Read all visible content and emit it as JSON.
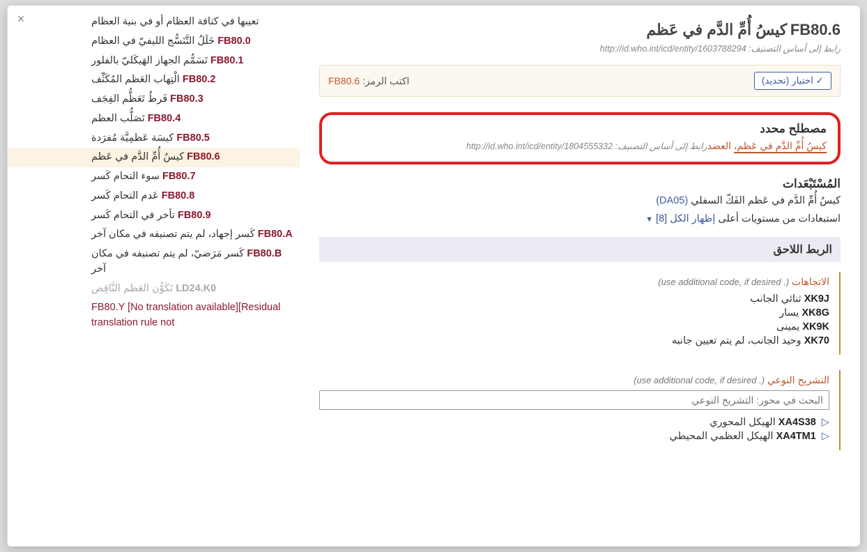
{
  "close_label": "×",
  "header": {
    "code": "FB80.6",
    "title": "كيسُ أُمِّ الدَّم في عَظم",
    "foundation_label": "رابط إلى أساس التصنيف:",
    "foundation_uri": "http://id.who.int/icd/entity/1603788294"
  },
  "select_bar": {
    "button": "✓ اختيار (تحديد)",
    "entry_label": "اكتب الرمز:",
    "entry_code": "FB80.6"
  },
  "matched_term": {
    "heading": "مصطلح محدد",
    "term": "كيسُ أُمِّ الدَّم في عَظم،",
    "extra": "العضد",
    "foundation_label": "رابط إلى أساس التصنيف:",
    "uri": "http://id.who.int/icd/entity/1804555332"
  },
  "exclusions": {
    "heading": "المُسْتَبْعَدات",
    "items": [
      {
        "text": "كيسُ أُمِّ الدَّم في عَظم الفَكّ السفلي",
        "code": "(DA05)"
      }
    ],
    "showall_label": "استبعادات من مستويات أعلى",
    "showall_link": "إظهار الكل [8]"
  },
  "postcoord_heading": "الربط اللاحق",
  "axis1": {
    "name": "الاتجاهات",
    "note": "(. use additional code, if desired)",
    "items": [
      {
        "code": "XK9J",
        "label": "ثنائي الجانب"
      },
      {
        "code": "XK8G",
        "label": "يسار"
      },
      {
        "code": "XK9K",
        "label": "يمينى"
      },
      {
        "code": "XK70",
        "label": "وحيد الجانب، لم يتم تعيين جانبه"
      }
    ]
  },
  "axis2": {
    "name": "التشريح النوعي",
    "note": "(. use additional code, if desired)",
    "search_placeholder": "البحث في محور: التشريح النوعي",
    "items": [
      {
        "code": "XA4S38",
        "label": "الهيكل المحوري"
      },
      {
        "code": "XA4TM1",
        "label": "الهيكل العظمي المحيطي"
      }
    ]
  },
  "nav": [
    {
      "code": "",
      "label": "تعيبها في كتافة العظام أو في بنية العظام",
      "sel": false,
      "muted": false
    },
    {
      "code": "FB80.0",
      "label": "خَلَلُ التَّنَسُّج الليفيّ في العظام",
      "sel": false
    },
    {
      "code": "FB80.1",
      "label": "تَسَمُّم الجهاز الهَيكَليّ بالفلور",
      "sel": false
    },
    {
      "code": "FB80.2",
      "label": "الْتِهاب العَظم المُكَثِّف",
      "sel": false
    },
    {
      "code": "FB80.3",
      "label": "فَرطُ تَعَظُّم الفِجَف",
      "sel": false
    },
    {
      "code": "FB80.4",
      "label": "تَصَلُّب العظم",
      "sel": false
    },
    {
      "code": "FB80.5",
      "label": "كيسَة عَظمِيَّة مُفرَدة",
      "sel": false
    },
    {
      "code": "FB80.6",
      "label": "كيسُ أُمِّ الدَّم في عَظم",
      "sel": true
    },
    {
      "code": "FB80.7",
      "label": "سوء التحام كَسر",
      "sel": false
    },
    {
      "code": "FB80.8",
      "label": "عَدم التحام كَسر",
      "sel": false
    },
    {
      "code": "FB80.9",
      "label": "تأخر في التحام كَسر",
      "sel": false
    },
    {
      "code": "FB80.A",
      "label": "كَسر إجهاد، لم يتم تصنيفه في مكان آخر",
      "sel": false
    },
    {
      "code": "FB80.B",
      "label": "كَسر مَرَضيّ، لم يتم تصنيفه في مكان آخر",
      "sel": false
    },
    {
      "code": "LD24.K0",
      "label": "تَكَوُّن العَظم النَّاقِص",
      "sel": false,
      "muted": true
    },
    {
      "code": "FB80.Y",
      "label": "[No translation available][Residual translation rule not",
      "sel": false,
      "bracket": true
    }
  ]
}
